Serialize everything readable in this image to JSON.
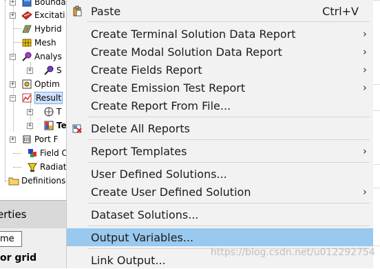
{
  "tree": {
    "items": [
      {
        "label": "Bounda",
        "icon": "boundary-icon"
      },
      {
        "label": "Excitati",
        "icon": "excitation-icon"
      },
      {
        "label": "Hybrid",
        "icon": "hybrid-icon"
      },
      {
        "label": "Mesh",
        "icon": "mesh-icon"
      },
      {
        "label": "Analys",
        "icon": "analysis-icon"
      },
      {
        "label": "S",
        "icon": "setup-icon"
      },
      {
        "label": "Optim",
        "icon": "optimetrics-icon"
      },
      {
        "label": "Result",
        "icon": "results-icon"
      },
      {
        "label": "T",
        "icon": "plot-icon"
      },
      {
        "label": "Te",
        "icon": "report-icon"
      },
      {
        "label": "Port F",
        "icon": "port-field-icon"
      },
      {
        "label": "Field C",
        "icon": "field-overlay-icon"
      },
      {
        "label": "Radiati",
        "icon": "radiation-icon"
      },
      {
        "label": "Definitions",
        "icon": "folder-icon"
      }
    ]
  },
  "properties": {
    "title": "erties",
    "column_header": "me",
    "row_label": "or grid"
  },
  "menu": {
    "items": [
      {
        "label": "Paste",
        "shortcut": "Ctrl+V",
        "icon": "paste-icon"
      },
      {
        "label": "Create Terminal Solution Data Report",
        "submenu": "›"
      },
      {
        "label": "Create Modal Solution Data Report",
        "submenu": "›"
      },
      {
        "label": "Create Fields Report",
        "submenu": "›"
      },
      {
        "label": "Create Emission Test Report",
        "submenu": "›"
      },
      {
        "label": "Create Report From File..."
      },
      {
        "label": "Delete All Reports",
        "icon": "delete-reports-icon"
      },
      {
        "label": "Report Templates",
        "submenu": "›"
      },
      {
        "label": "User Defined Solutions..."
      },
      {
        "label": "Create User Defined Solution",
        "submenu": "›"
      },
      {
        "label": "Dataset Solutions..."
      },
      {
        "label": "Output Variables..."
      },
      {
        "label": "Link Output..."
      }
    ]
  },
  "colors": {
    "highlight": "#99c9ef",
    "menu_bg": "#f2f2f2"
  },
  "watermark": "https://blog.csdn.net/u012292754"
}
